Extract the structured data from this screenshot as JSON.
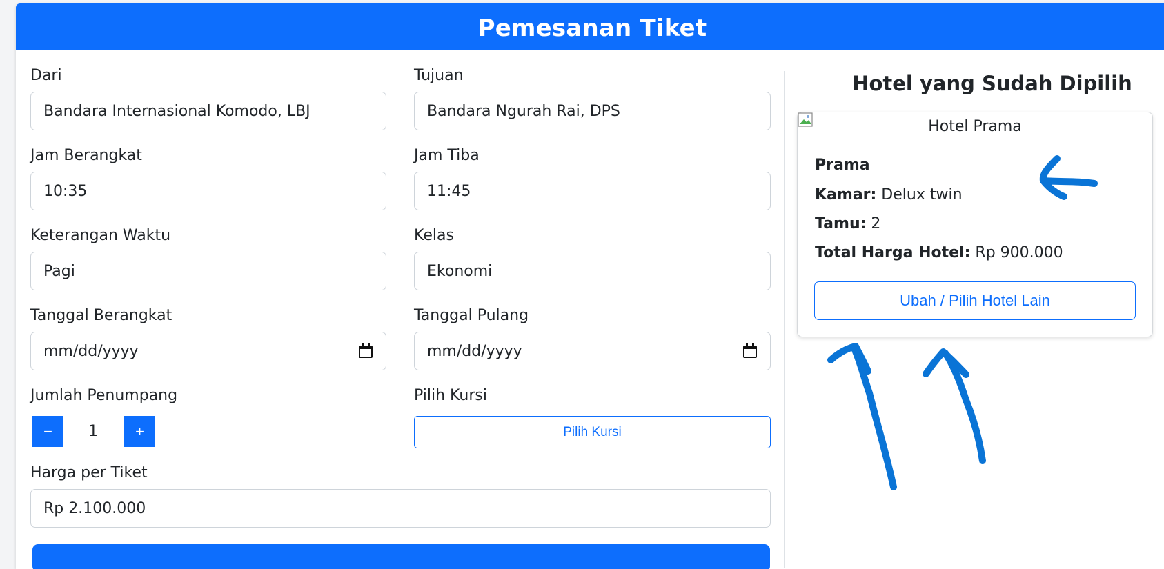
{
  "header": {
    "title": "Pemesanan Tiket"
  },
  "form": {
    "dari": {
      "label": "Dari",
      "value": "Bandara Internasional Komodo, LBJ"
    },
    "tujuan": {
      "label": "Tujuan",
      "value": "Bandara Ngurah Rai, DPS"
    },
    "jam_berangkat": {
      "label": "Jam Berangkat",
      "value": "10:35"
    },
    "jam_tiba": {
      "label": "Jam Tiba",
      "value": "11:45"
    },
    "keterangan_waktu": {
      "label": "Keterangan Waktu",
      "value": "Pagi"
    },
    "kelas": {
      "label": "Kelas",
      "value": "Ekonomi"
    },
    "tanggal_berangkat": {
      "label": "Tanggal Berangkat",
      "placeholder": "mm/dd/yyyy"
    },
    "tanggal_pulang": {
      "label": "Tanggal Pulang",
      "placeholder": "mm/dd/yyyy"
    },
    "jumlah_penumpang": {
      "label": "Jumlah Penumpang",
      "minus": "−",
      "value": "1",
      "plus": "+"
    },
    "pilih_kursi": {
      "label": "Pilih Kursi",
      "button": "Pilih Kursi"
    },
    "harga_per_tiket": {
      "label": "Harga per Tiket",
      "value": "Rp 2.100.000"
    }
  },
  "hotel": {
    "section_title": "Hotel yang Sudah Dipilih",
    "image_alt": "Hotel Prama",
    "name": "Prama",
    "kamar_label": "Kamar:",
    "kamar_value": " Delux twin",
    "tamu_label": "Tamu:",
    "tamu_value": " 2",
    "total_label": "Total Harga Hotel:",
    "total_value": " Rp 900.000",
    "change_button": "Ubah / Pilih Hotel Lain"
  },
  "colors": {
    "primary": "#0d6efd",
    "annotation": "#0a74d6"
  },
  "icons": [
    "calendar-icon",
    "broken-image-icon"
  ]
}
